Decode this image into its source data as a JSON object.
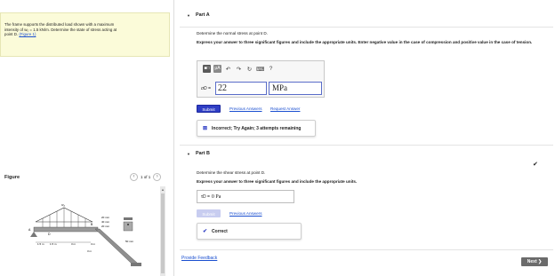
{
  "problem": {
    "line1": "The frame supports the distributed load shown with a maximum",
    "line2": "intensity of w₀ = 1.5 kN/m. Determine the state of stress acting at",
    "line3_prefix": "point D.",
    "figure_link": "(Figure 1)"
  },
  "figure": {
    "label": "Figure",
    "pager_text": "1 of 1",
    "prev_icon": "chevron-left-icon",
    "next_icon": "chevron-right-icon",
    "dims": {
      "w0": "w₀",
      "point_A": "A",
      "point_D": "D",
      "point_B": "B",
      "dim_1": "1.5 m",
      "dim_2": "1.5 m",
      "dim_3": "3 m",
      "dim_4": "3 m",
      "dim_5": "3 m",
      "sec_20a": "20 mm",
      "sec_40": "40 mm",
      "sec_20b": "20 mm",
      "sec_50": "50 mm"
    }
  },
  "partA": {
    "title": "Part A",
    "question": "Determine the normal stress at point D.",
    "instructions": "Express your answer to three significant figures and include the appropriate units. Enter negative value in the case of compression and positive value in the case of tension.",
    "symbol": "σD =",
    "value": "22",
    "unit": "MPa",
    "toolbar": {
      "template_label": "■□",
      "mu_label": "μA",
      "help_label": "?"
    },
    "submit_label": "Submit",
    "previous_answers": "Previous Answers",
    "request_answer": "Request Answer",
    "feedback": "Incorrect; Try Again; 3 attempts remaining"
  },
  "partB": {
    "title": "Part B",
    "question": "Determine the shear stress at point D.",
    "instructions": "Express your answer to three significant figures and include the appropriate units.",
    "symbol": "τD =",
    "value": "0 Pa",
    "submit_label": "Submit",
    "previous_answers": "Previous Answers",
    "feedback": "Correct"
  },
  "footer": {
    "provide_feedback": "Provide Feedback",
    "next_label": "Next ❯"
  },
  "colors": {
    "accent": "#2f3ec4",
    "link": "#1a4fd0",
    "problem_bg": "#fbfbd9"
  }
}
